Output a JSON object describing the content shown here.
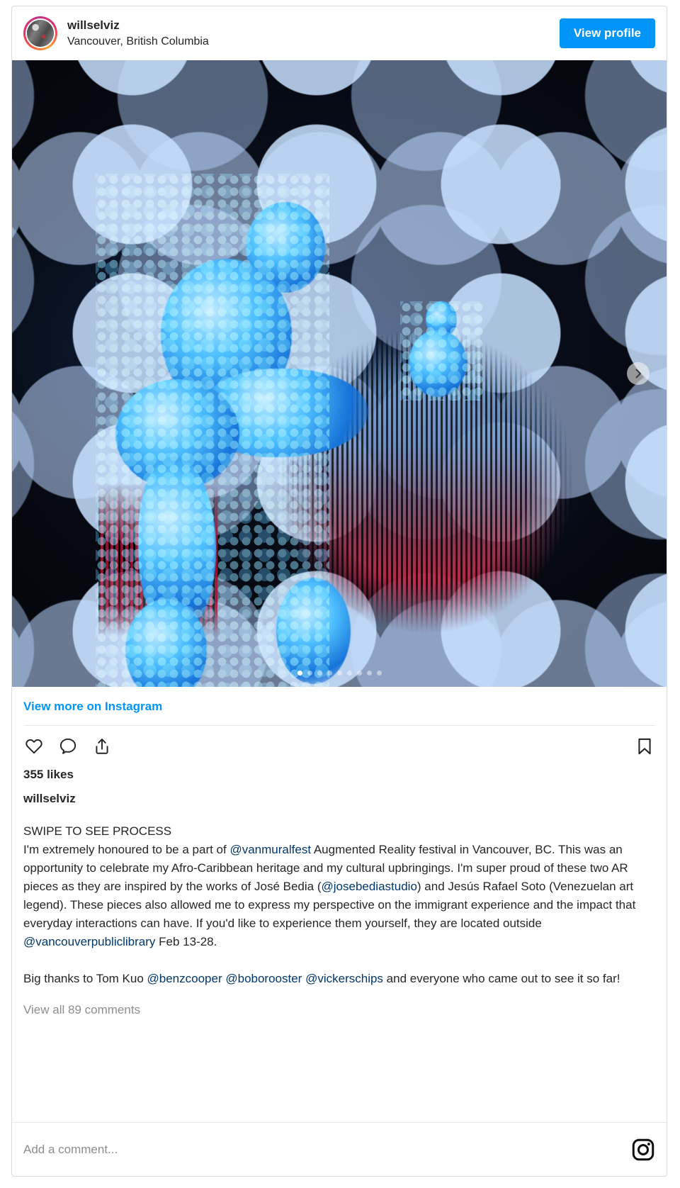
{
  "colors": {
    "instagram_blue": "#0095f6",
    "mention_blue": "#00376b",
    "text": "#262626",
    "muted": "#8e8e8e",
    "border": "#dbdbdb"
  },
  "header": {
    "username": "willselviz",
    "location": "Vancouver, British Columbia",
    "view_profile_label": "View profile",
    "avatar_icon": "avatar-image"
  },
  "media": {
    "next_icon": "chevron-right-icon",
    "dot_count": 9,
    "active_dot_index": 0
  },
  "post": {
    "view_more_label": "View more on Instagram",
    "like_icon": "heart-icon",
    "comment_icon": "comment-bubble-icon",
    "share_icon": "share-icon",
    "bookmark_icon": "bookmark-icon",
    "likes": "355 likes",
    "caption_username": "willselviz",
    "caption_parts": [
      {
        "type": "text",
        "value": "SWIPE TO SEE PROCESS\nI'm extremely honoured to be a part of "
      },
      {
        "type": "mention",
        "value": "@vanmuralfest"
      },
      {
        "type": "text",
        "value": " Augmented Reality festival in Vancouver, BC. This was an opportunity to celebrate my Afro-Caribbean heritage and my cultural upbringings. I'm super proud of these two AR pieces as they are inspired by the works of José Bedia ("
      },
      {
        "type": "mention",
        "value": "@josebediastudio"
      },
      {
        "type": "text",
        "value": ") and Jesús Rafael Soto (Venezuelan art legend). These pieces also allowed me to express my perspective on the immigrant experience and the impact that everyday interactions can have. If you'd like to experience them yourself, they are located outside "
      },
      {
        "type": "mention",
        "value": "@vancouverpubliclibrary"
      },
      {
        "type": "text",
        "value": " Feb 13-28.\n\nBig thanks to Tom Kuo "
      },
      {
        "type": "mention",
        "value": "@benzcooper"
      },
      {
        "type": "text",
        "value": " "
      },
      {
        "type": "mention",
        "value": "@boborooster"
      },
      {
        "type": "text",
        "value": " "
      },
      {
        "type": "mention",
        "value": "@vickerschips"
      },
      {
        "type": "text",
        "value": " and everyone who came out to see it so far!"
      }
    ],
    "view_comments_label": "View all 89 comments"
  },
  "footer": {
    "comment_placeholder": "Add a comment...",
    "instagram_icon": "instagram-logo-icon"
  }
}
